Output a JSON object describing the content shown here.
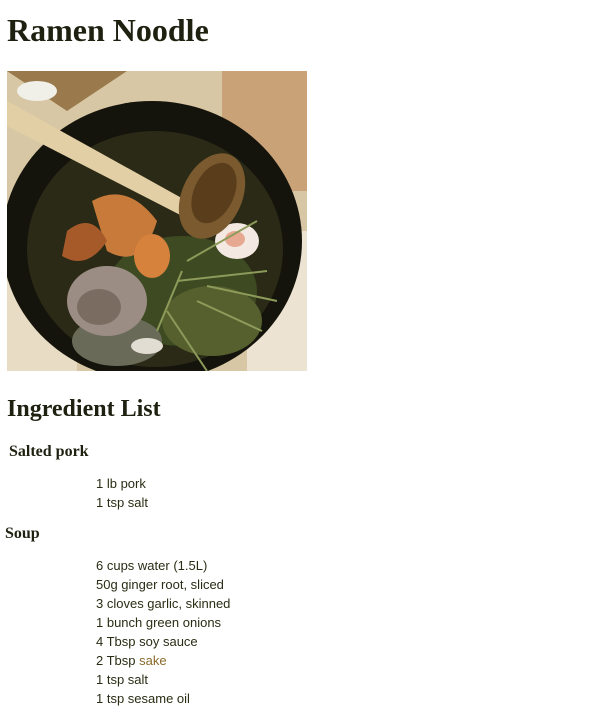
{
  "page": {
    "title": "Ramen Noodle"
  },
  "photo": {
    "icon": "ramen-bowl-photo"
  },
  "ingredients": {
    "heading": "Ingredient List",
    "groups": [
      {
        "name": "Salted pork",
        "items": [
          {
            "text": "1 lb pork"
          },
          {
            "text": "1 tsp salt"
          }
        ]
      },
      {
        "name": "Soup",
        "items": [
          {
            "text": "6 cups water (1.5L)"
          },
          {
            "text": "50g ginger root, sliced"
          },
          {
            "text": "3 cloves garlic, skinned"
          },
          {
            "text": "1 bunch green onions"
          },
          {
            "text": "4 Tbsp soy sauce"
          },
          {
            "prefix": "2 Tbsp ",
            "link": "sake"
          },
          {
            "text": "1 tsp salt"
          },
          {
            "text": "1 tsp sesame oil"
          }
        ]
      }
    ]
  },
  "colors": {
    "link": "#8a6a2a",
    "text": "#222a10"
  }
}
